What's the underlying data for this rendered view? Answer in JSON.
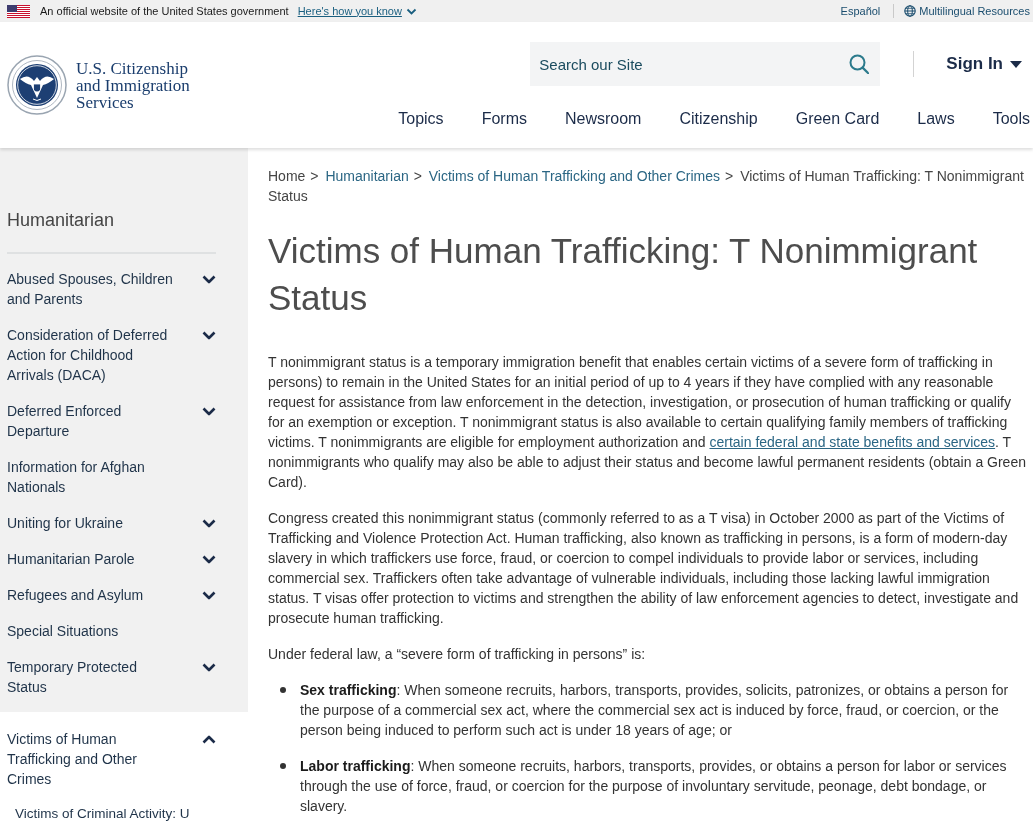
{
  "gov_banner": {
    "text": "An official website of the United States government",
    "link": "Here's how you know",
    "language_link": "Español",
    "resources_link": "Multilingual Resources"
  },
  "header": {
    "agency_name": "U.S. Citizenship and Immigration Services",
    "search": {
      "placeholder": "Search our Site"
    },
    "sign_in": "Sign In",
    "nav": [
      "Topics",
      "Forms",
      "Newsroom",
      "Citizenship",
      "Green Card",
      "Laws",
      "Tools"
    ]
  },
  "sidebar": {
    "heading": "Humanitarian",
    "items": [
      {
        "label": "Abused Spouses, Children and Parents",
        "kind": "group",
        "expanded": false
      },
      {
        "label": "Consideration of Deferred Action for Childhood Arrivals (DACA)",
        "kind": "group",
        "expanded": false
      },
      {
        "label": "Deferred Enforced Departure",
        "kind": "group",
        "expanded": false
      },
      {
        "label": "Information for Afghan Nationals",
        "kind": "link",
        "expanded": false
      },
      {
        "label": "Uniting for Ukraine",
        "kind": "group",
        "expanded": false
      },
      {
        "label": "Humanitarian Parole",
        "kind": "group",
        "expanded": false
      },
      {
        "label": "Refugees and Asylum",
        "kind": "group",
        "expanded": false
      },
      {
        "label": "Special Situations",
        "kind": "link",
        "expanded": false
      },
      {
        "label": "Temporary Protected Status",
        "kind": "group",
        "expanded": false
      },
      {
        "label": "Victims of Human Trafficking and Other Crimes",
        "kind": "group",
        "expanded": true,
        "children": [
          {
            "label": "Victims of Criminal Activity: U"
          }
        ]
      }
    ]
  },
  "breadcrumb": [
    {
      "label": "Home",
      "kind": "home",
      "separator": ">"
    },
    {
      "label": "Humanitarian",
      "kind": "link",
      "separator": ">"
    },
    {
      "label": "Victims of Human Trafficking and Other Crimes",
      "kind": "link",
      "separator": ">"
    },
    {
      "label": "Victims of Human Trafficking: T Nonimmigrant Status",
      "kind": "current"
    }
  ],
  "title": "Victims of Human Trafficking: T Nonimmigrant Status",
  "paragraphs": [
    {
      "segments": [
        {
          "kind": "text",
          "text": "T nonimmigrant status is a temporary immigration benefit that enables certain victims of a severe form of trafficking in persons) to remain in the United States for an initial period of up to 4 years if they have complied with any reasonable request for assistance from law enforcement in the detection, investigation, or prosecution of human trafficking or qualify for an exemption or exception. T nonimmigrant status is also available to certain qualifying family members of trafficking victims. T nonimmigrants are eligible for employment authorization and "
        },
        {
          "kind": "link",
          "text": "certain federal and state benefits and services"
        },
        {
          "kind": "text",
          "text": ". T nonimmigrants who qualify may also be able to adjust their status and become lawful permanent residents (obtain a Green Card)."
        }
      ]
    },
    {
      "segments": [
        {
          "kind": "text",
          "text": "Congress created this nonimmigrant status (commonly referred to as a T visa) in October 2000 as part of the Victims of Trafficking and Violence Protection Act. Human trafficking, also known as trafficking in persons, is a form of modern-day slavery in which traffickers use force, fraud, or coercion to compel individuals to provide labor or services, including commercial sex. Traffickers often take advantage of vulnerable individuals, including those lacking lawful immigration status. T visas offer protection to victims and strengthen the ability of law enforcement agencies to detect, investigate and prosecute human trafficking."
        }
      ]
    },
    {
      "segments": [
        {
          "kind": "text",
          "text": "Under federal law, a “severe form of trafficking in persons” is:"
        }
      ]
    }
  ],
  "definitions": [
    {
      "text": "**Sex trafficking**: When someone recruits, harbors, transports, provides, solicits, patronizes, or obtains a person for the purpose of a commercial sex act, where the commercial sex act is induced by force, fraud, or coercion, or the person being induced to perform such act is under 18 years of age; or"
    },
    {
      "text": "**Labor trafficking**: When someone recruits, harbors, transports, provides, or obtains a person for labor or services through the use of force, fraud, or coercion for the purpose of involuntary servitude, peonage, debt bondage, or slavery."
    }
  ]
}
